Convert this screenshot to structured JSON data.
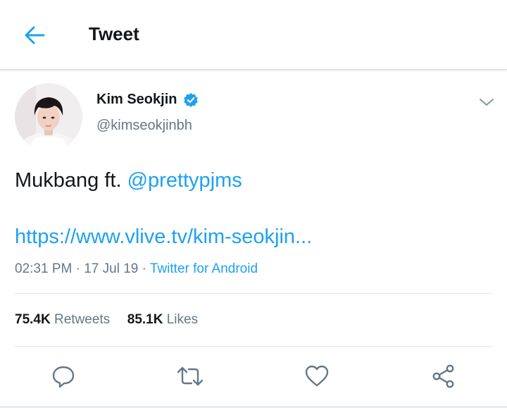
{
  "header": {
    "title": "Tweet",
    "back_icon": "arrow-left-icon"
  },
  "tweet": {
    "author_name": "Kim Seokjin",
    "author_handle": "@kimseokjinbh",
    "verified": true,
    "text_prefix": "Mukbang ft. ",
    "mention": "@prettypjms",
    "link": "https://www.vlive.tv/kim-seokjin...",
    "time": "02:31 PM",
    "date": "17 Jul 19",
    "source": "Twitter for Android",
    "retweets_count": "75.4K",
    "retweets_label": "Retweets",
    "likes_count": "85.1K",
    "likes_label": "Likes"
  },
  "actions": [
    "reply-icon",
    "retweet-icon",
    "like-icon",
    "share-icon"
  ],
  "colors": {
    "accent": "#1da1f2",
    "text": "#14171a",
    "secondary": "#657786",
    "divider": "#dfe3e6"
  }
}
